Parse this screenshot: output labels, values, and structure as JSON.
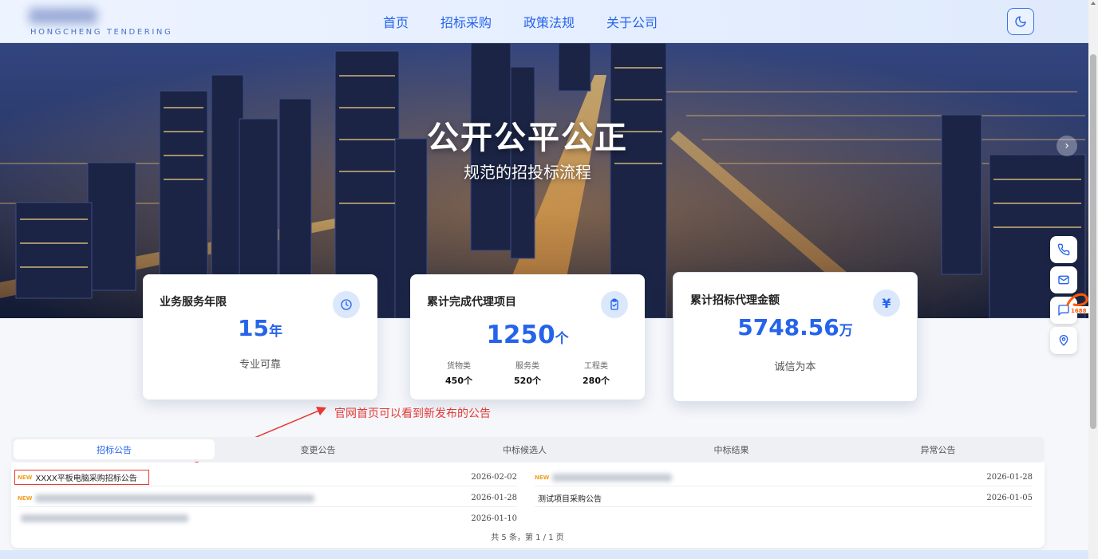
{
  "header": {
    "logo_sub": "HONGCHENG TENDERING",
    "nav": [
      "首页",
      "招标采购",
      "政策法规",
      "关于公司"
    ]
  },
  "hero": {
    "title": "公开公平公正",
    "subtitle": "规范的招投标流程"
  },
  "stats": [
    {
      "title": "业务服务年限",
      "value": "15",
      "unit": "年",
      "note": "专业可靠",
      "icon": "clock-icon"
    },
    {
      "title": "累计完成代理项目",
      "value": "1250",
      "unit": "个",
      "icon": "clipboard-check-icon",
      "breakdown": [
        {
          "label": "货物类",
          "value": "450个"
        },
        {
          "label": "服务类",
          "value": "520个"
        },
        {
          "label": "工程类",
          "value": "280个"
        }
      ]
    },
    {
      "title": "累计招标代理金额",
      "value": "5748.56",
      "unit": "万",
      "note": "诚信为本",
      "icon": "yen-icon"
    }
  ],
  "annotation": "官网首页可以看到新发布的公告",
  "tabs": [
    "招标公告",
    "变更公告",
    "中标候选人",
    "中标结果",
    "异常公告"
  ],
  "active_tab": "招标公告",
  "announcements_left": [
    {
      "new": "NEW",
      "title": "XXXX平板电脑采购招标公告",
      "date": "2026-02-02"
    },
    {
      "new": "NEW",
      "title": "",
      "date": "2026-01-28"
    },
    {
      "new": "",
      "title": "",
      "date": "2026-01-10"
    }
  ],
  "announcements_right": [
    {
      "new": "NEW",
      "title": "",
      "date": "2026-01-28"
    },
    {
      "new": "",
      "title": "测试项目采购公告",
      "date": "2026-01-05"
    }
  ],
  "pager": "共 5 条，第 1 / 1 页",
  "colors": {
    "accent": "#2563eb",
    "annotation": "#e53935",
    "new_badge": "#f0a020"
  }
}
